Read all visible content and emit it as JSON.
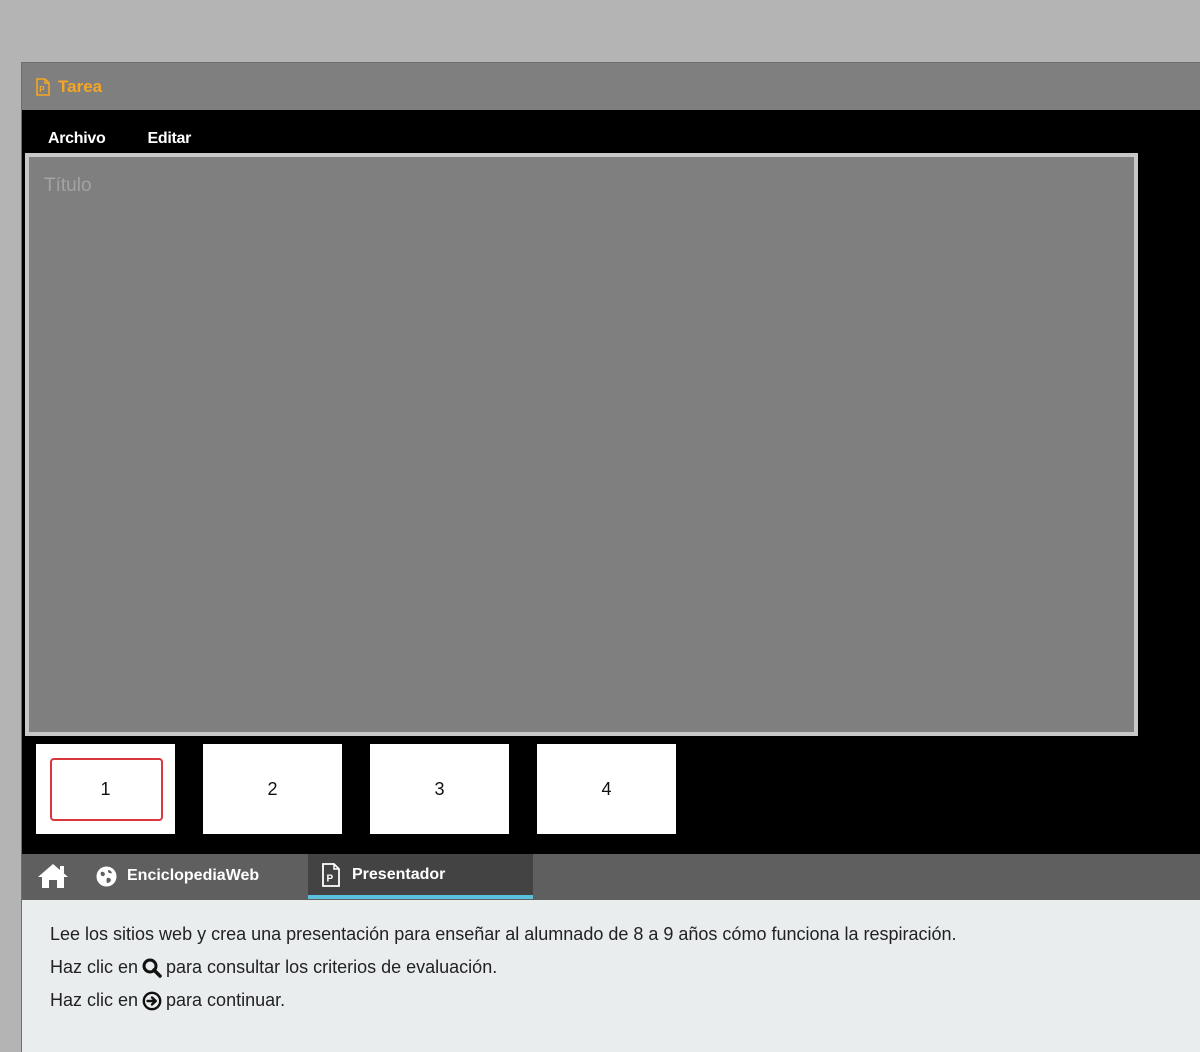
{
  "window": {
    "title": "Tarea",
    "title_color": "#f5a623"
  },
  "menu": {
    "items": [
      "Archivo",
      "Editar"
    ]
  },
  "slide": {
    "title_placeholder": "Título"
  },
  "thumbnails": [
    {
      "label": "1",
      "selected": true
    },
    {
      "label": "2",
      "selected": false
    },
    {
      "label": "3",
      "selected": false
    },
    {
      "label": "4",
      "selected": false
    }
  ],
  "taskbar": {
    "home_icon": "home-icon",
    "tabs": [
      {
        "label": "EnciclopediaWeb",
        "icon": "globe-icon",
        "active": false
      },
      {
        "label": "Presentador",
        "icon": "presentation-doc-icon",
        "active": true
      }
    ],
    "active_tab_accent": "#5bc0de"
  },
  "instructions": {
    "line1": "Lee los sitios web y crea una presentación para enseñar al alumnado de 8 a 9 años cómo funciona la respiración.",
    "line2_before": "Haz clic en",
    "line2_after": "para consultar los criterios de evaluación.",
    "line3_before": "Haz clic en",
    "line3_after": "para continuar."
  }
}
